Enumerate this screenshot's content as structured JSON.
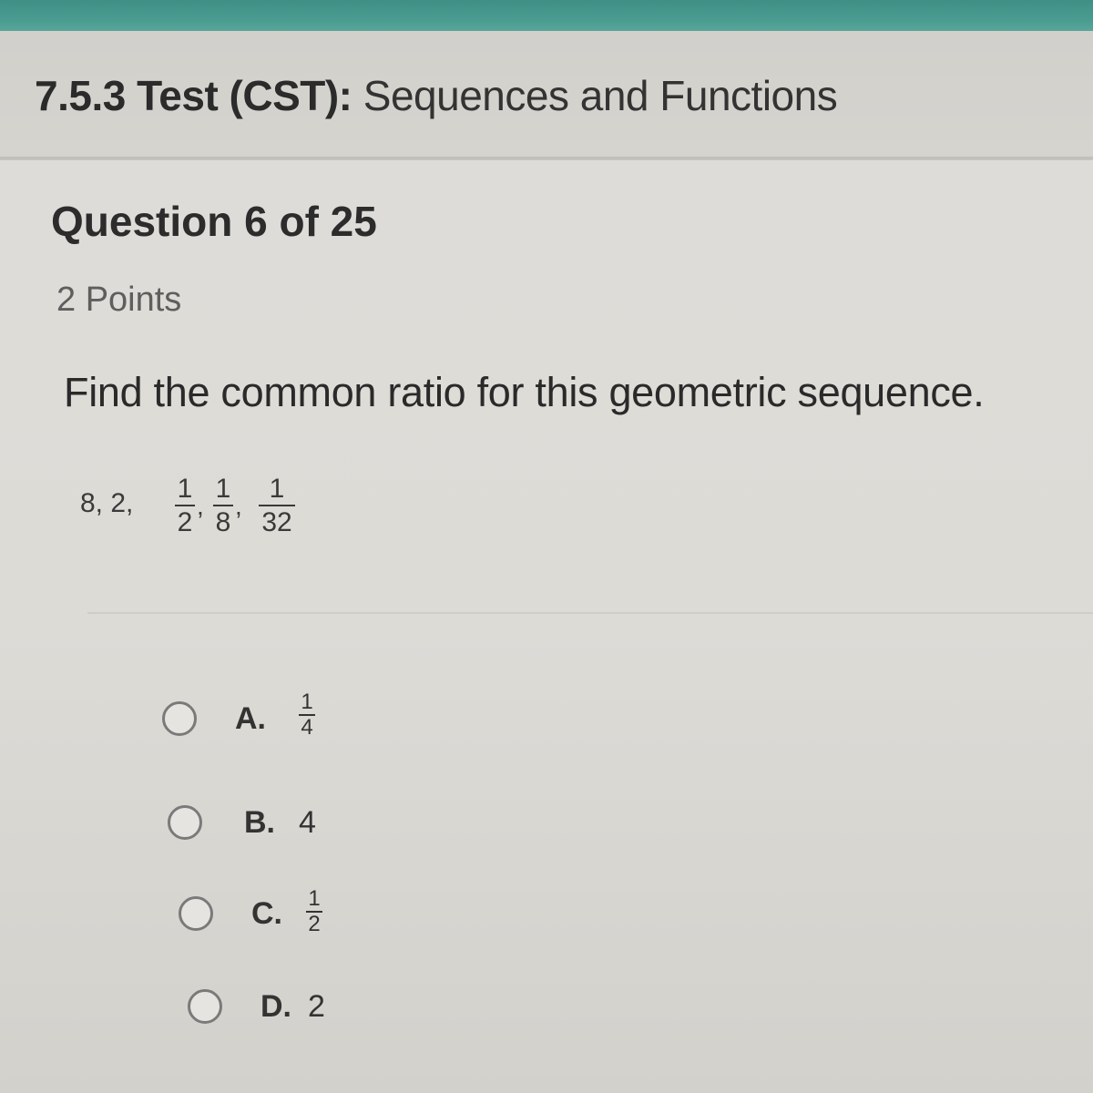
{
  "header": {
    "code": "7.5.3 Test (CST):",
    "name": "Sequences and Functions"
  },
  "question": {
    "number_label": "Question 6 of 25",
    "points_label": "2 Points",
    "prompt": "Find the common ratio for this geometric sequence.",
    "sequence": {
      "leading": "8, 2,",
      "fractions": [
        {
          "num": "1",
          "den": "2"
        },
        {
          "num": "1",
          "den": "8"
        },
        {
          "num": "1",
          "den": "32"
        }
      ],
      "separator": ","
    }
  },
  "choices": [
    {
      "letter": "A.",
      "type": "fraction",
      "num": "1",
      "den": "4",
      "selected": false
    },
    {
      "letter": "B.",
      "type": "text",
      "value": "4",
      "selected": false
    },
    {
      "letter": "C.",
      "type": "fraction",
      "num": "1",
      "den": "2",
      "selected": false
    },
    {
      "letter": "D.",
      "type": "text",
      "value": "2",
      "selected": false
    }
  ],
  "colors": {
    "accent": "#4b9d92",
    "background": "#dedcd8",
    "text": "#2a2a2a"
  }
}
